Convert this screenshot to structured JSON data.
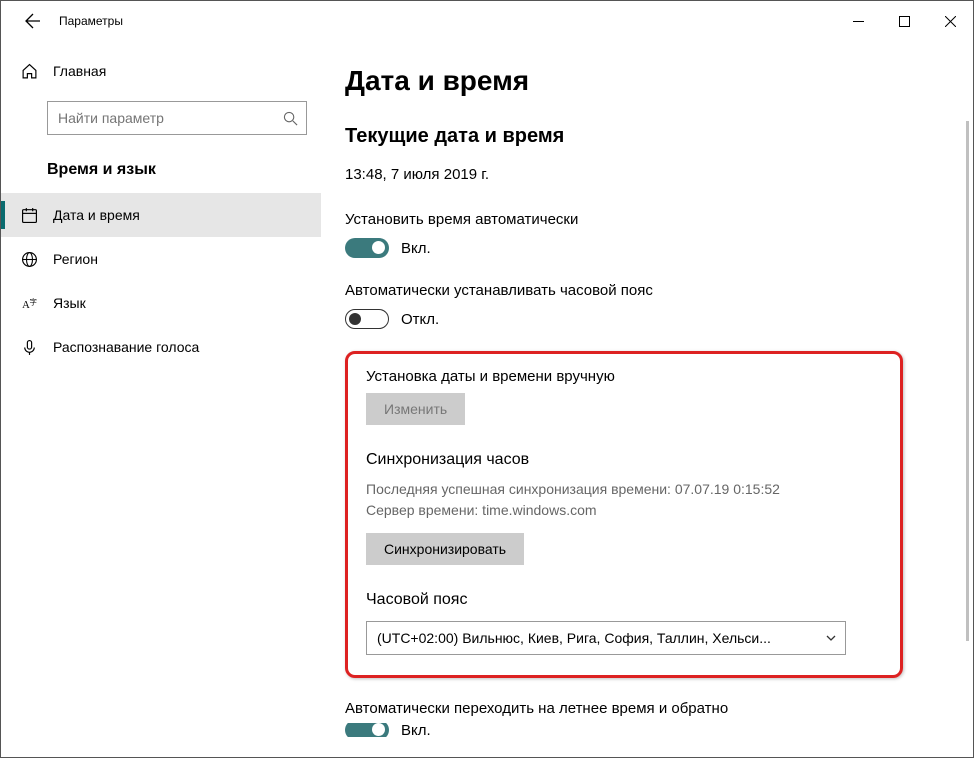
{
  "titlebar": {
    "title": "Параметры"
  },
  "sidebar": {
    "home_label": "Главная",
    "search_placeholder": "Найти параметр",
    "category": "Время и язык",
    "items": [
      {
        "label": "Дата и время"
      },
      {
        "label": "Регион"
      },
      {
        "label": "Язык"
      },
      {
        "label": "Распознавание голоса"
      }
    ]
  },
  "main": {
    "page_title": "Дата и время",
    "current_section": "Текущие дата и время",
    "current_value": "13:48, 7 июля 2019 г.",
    "auto_time_label": "Установить время автоматически",
    "auto_time_state": "Вкл.",
    "auto_tz_label": "Автоматически устанавливать часовой пояс",
    "auto_tz_state": "Откл.",
    "manual_label": "Установка даты и времени вручную",
    "change_btn": "Изменить",
    "sync_title": "Синхронизация часов",
    "sync_last": "Последняя успешная синхронизация времени: 07.07.19 0:15:52",
    "sync_server": "Сервер времени: time.windows.com",
    "sync_btn": "Синхронизировать",
    "tz_title": "Часовой пояс",
    "tz_value": "(UTC+02:00) Вильнюс, Киев, Рига, София, Таллин, Хельси...",
    "dst_label": "Автоматически переходить на летнее время и обратно",
    "dst_state": "Вкл."
  }
}
